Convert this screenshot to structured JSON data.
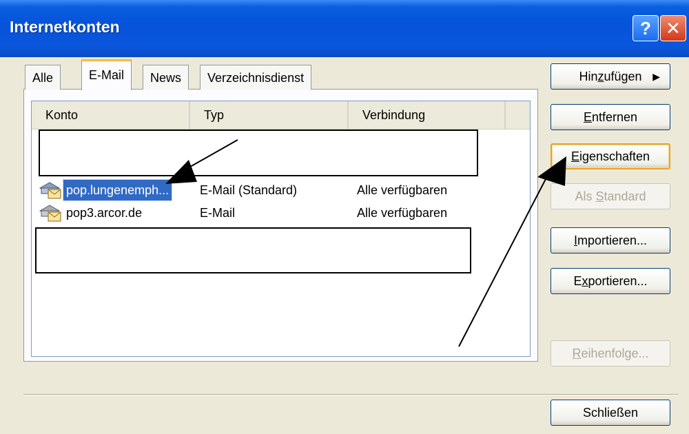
{
  "window": {
    "title": "Internetkonten",
    "help_label": "?",
    "close_label": "✕"
  },
  "tabs": [
    {
      "label": "Alle",
      "active": false
    },
    {
      "label": "E-Mail",
      "active": true
    },
    {
      "label": "News",
      "active": false
    },
    {
      "label": "Verzeichnisdienst",
      "active": false
    }
  ],
  "list": {
    "columns": [
      "Konto",
      "Typ",
      "Verbindung"
    ],
    "rows": [
      {
        "name": "pop.lungenemph...",
        "type": "E-Mail (Standard)",
        "connection": "Alle verfügbaren",
        "selected": true,
        "icon": "mail-account-icon"
      },
      {
        "name": "pop3.arcor.de",
        "type": "E-Mail",
        "connection": "Alle verfügbaren",
        "selected": false,
        "icon": "mail-account-icon"
      }
    ]
  },
  "buttons": {
    "add": {
      "pre": "Hin",
      "key": "z",
      "post": "ufügen",
      "arrow": "▶"
    },
    "remove": {
      "pre": "",
      "key": "E",
      "post": "ntfernen"
    },
    "properties": {
      "pre": "",
      "key": "E",
      "post": "igenschaften"
    },
    "set_default": {
      "pre": "Als ",
      "key": "S",
      "post": "tandard"
    },
    "import": {
      "pre": "",
      "key": "I",
      "post": "mportieren..."
    },
    "export": {
      "pre": "E",
      "key": "x",
      "post": "portieren..."
    },
    "order": {
      "pre": "",
      "key": "R",
      "post": "eihenfolge..."
    },
    "close": {
      "label": "Schließen"
    }
  },
  "colors": {
    "titlebar": "#0553d9",
    "selection": "#316ac5",
    "default_button_border": "#e3a52a",
    "dialog_background": "#ece9d8"
  }
}
